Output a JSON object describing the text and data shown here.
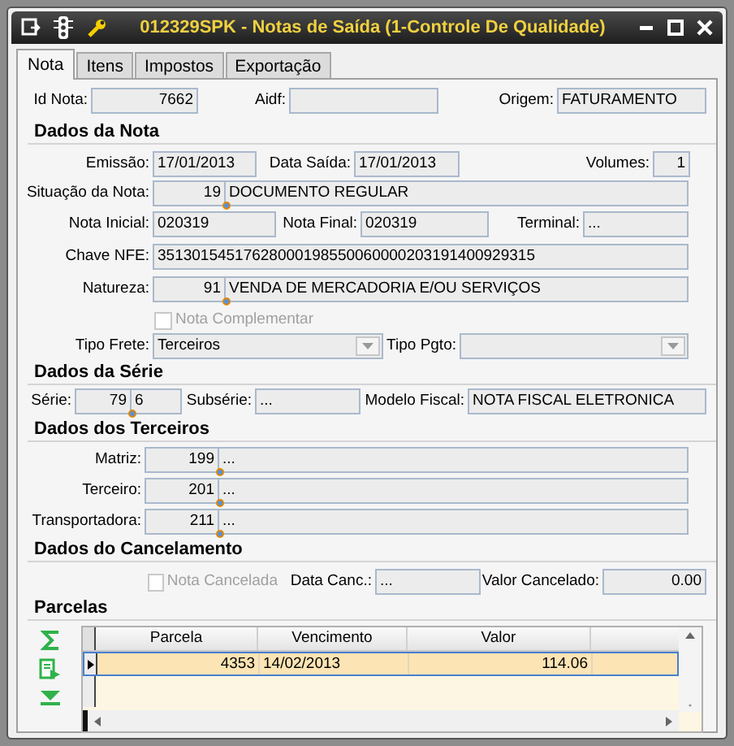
{
  "window": {
    "title": "012329SPK - Notas de Saída (1-Controle De Qualidade)"
  },
  "tabs": [
    {
      "label": "Nota",
      "selected": true
    },
    {
      "label": "Itens",
      "selected": false
    },
    {
      "label": "Impostos",
      "selected": false
    },
    {
      "label": "Exportação",
      "selected": false
    }
  ],
  "id_nota": {
    "label": "Id Nota:",
    "value": "7662"
  },
  "aidf": {
    "label": "Aidf:"
  },
  "origem": {
    "label": "Origem:",
    "value": "FATURAMENTO"
  },
  "dados_da_nota": {
    "heading": "Dados da Nota",
    "emissao": {
      "label": "Emissão:",
      "value": "17/01/2013"
    },
    "data_saida": {
      "label": "Data Saída:",
      "value": "17/01/2013"
    },
    "volumes": {
      "label": "Volumes:",
      "value": "1"
    },
    "situacao": {
      "label": "Situação da Nota:",
      "code": "19",
      "value": "DOCUMENTO REGULAR"
    },
    "nota_inicial": {
      "label": "Nota Inicial:",
      "value": "020319"
    },
    "nota_final": {
      "label": "Nota Final:",
      "value": "020319"
    },
    "terminal": {
      "label": "Terminal:",
      "value": "..."
    },
    "chave_nfe": {
      "label": "Chave NFE:",
      "value": "35130154517628000198550060000203191400929315"
    },
    "natureza": {
      "label": "Natureza:",
      "code": "91",
      "value": "VENDA DE MERCADORIA E/OU SERVIÇOS"
    },
    "nota_complementar": {
      "label": "Nota Complementar",
      "checked": false,
      "disabled": true
    },
    "tipo_frete": {
      "label": "Tipo Frete:",
      "value": "Terceiros"
    },
    "tipo_pgto": {
      "label": "Tipo Pgto:"
    }
  },
  "dados_da_serie": {
    "heading": "Dados da Série",
    "serie": {
      "label": "Série:",
      "code": "79",
      "value": "6"
    },
    "subserie": {
      "label": "Subsérie:",
      "value": "..."
    },
    "modelo_fiscal": {
      "label": "Modelo Fiscal:",
      "value": "NOTA FISCAL ELETRONICA"
    }
  },
  "dados_dos_terceiros": {
    "heading": "Dados dos Terceiros",
    "rows": [
      {
        "label": "Matriz:",
        "code": "199",
        "value": "..."
      },
      {
        "label": "Terceiro:",
        "code": "201",
        "value": "..."
      },
      {
        "label": "Transportadora:",
        "code": "211",
        "value": "..."
      }
    ]
  },
  "dados_do_cancelamento": {
    "heading": "Dados do Cancelamento",
    "nota_cancelada": {
      "label": "Nota Cancelada",
      "checked": false,
      "disabled": true
    },
    "data_canc": {
      "label": "Data Canc.:",
      "value": "..."
    },
    "valor_cancelado": {
      "label": "Valor Cancelado:",
      "value": "0.00"
    }
  },
  "parcelas": {
    "heading": "Parcelas",
    "columns": [
      "Parcela",
      "Vencimento",
      "Valor"
    ],
    "rows": [
      {
        "cells": [
          "4353",
          "14/02/2013",
          "114.06"
        ],
        "selected": true
      }
    ]
  }
}
